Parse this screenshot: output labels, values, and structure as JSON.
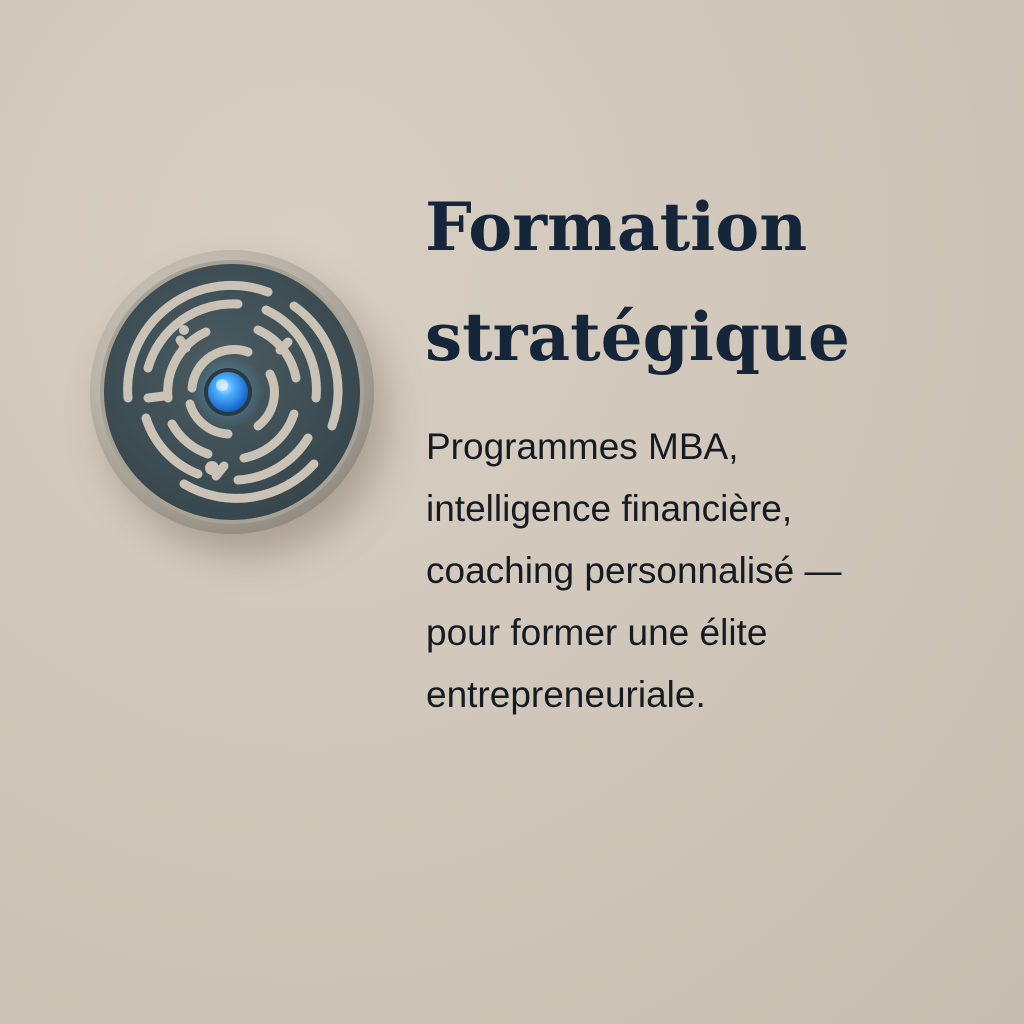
{
  "heading": {
    "lines": [
      "Formation",
      "stratégique"
    ]
  },
  "description": {
    "lines": [
      "Programmes MBA,",
      "intelligence financière,",
      "coaching personnalisé —",
      "pour former une élite",
      "entrepreneuriale."
    ]
  },
  "emblem": {
    "icon": "maze-icon",
    "center_icon": "glowing-orb-icon",
    "colors": {
      "rim": "#bdb6aa",
      "face": "#3f5157",
      "path": "#c9c2b5",
      "orb": "#2f9bff"
    }
  },
  "colors": {
    "background": "#d3cabd",
    "heading": "#16263a",
    "body_text": "#151b22"
  }
}
